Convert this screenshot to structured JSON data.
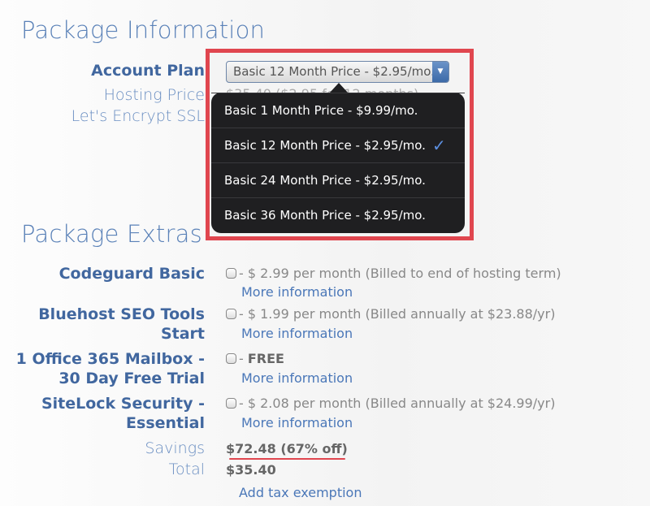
{
  "package_info": {
    "title": "Package Information",
    "account_plan_label": "Account Plan",
    "hosting_price_label": "Hosting Price",
    "hosting_price_value": "$35.40 ($2.95 for 12 months)",
    "ssl_label": "Let's Encrypt SSL",
    "selected_plan": "Basic 12 Month Price - $2.95/mo.",
    "plan_options": [
      {
        "label": "Basic 1 Month Price - $9.99/mo.",
        "selected": false
      },
      {
        "label": "Basic 12 Month Price - $2.95/mo.",
        "selected": true
      },
      {
        "label": "Basic 24 Month Price - $2.95/mo.",
        "selected": false
      },
      {
        "label": "Basic 36 Month Price - $2.95/mo.",
        "selected": false
      }
    ],
    "check_glyph": "✓",
    "arrow_glyph": "▼",
    "highlight_color": "#e0464f"
  },
  "extras": {
    "title": "Package Extras",
    "items": [
      {
        "name_line1": "Codeguard Basic",
        "name_line2": "",
        "desc": "- $ 2.99 per month (Billed to end of hosting term)",
        "more": "More information",
        "checked": false
      },
      {
        "name_line1": "Bluehost SEO Tools",
        "name_line2": "Start",
        "desc": "- $ 1.99 per month (Billed annually at $23.88/yr)",
        "more": "More information",
        "checked": false
      },
      {
        "name_line1": "1 Office 365 Mailbox -",
        "name_line2": "30 Day Free Trial",
        "desc": "FREE",
        "desc_prefix": "- ",
        "more": "More information",
        "checked": false
      },
      {
        "name_line1": "SiteLock Security -",
        "name_line2": "Essential",
        "desc": "- $ 2.08 per month (Billed annually at $24.99/yr)",
        "more": "More information",
        "checked": false
      }
    ]
  },
  "summary": {
    "savings_label": "Savings",
    "savings_value": "$72.48 (67% off)",
    "total_label": "Total",
    "total_value": "$35.40",
    "tax_link": "Add tax exemption"
  }
}
